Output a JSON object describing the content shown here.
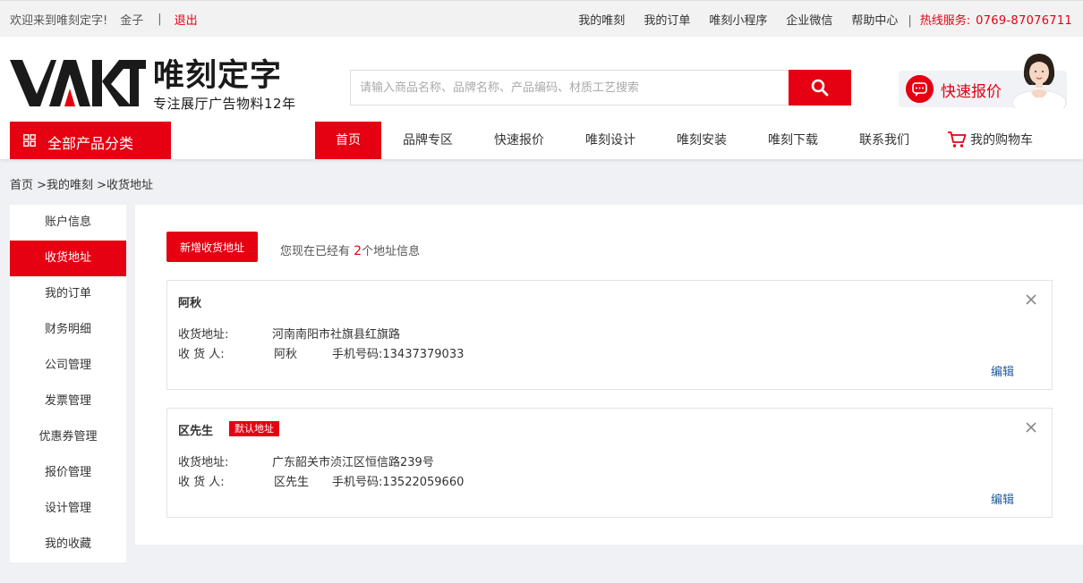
{
  "topbar": {
    "welcome": "欢迎来到唯刻定字!",
    "username": "金子",
    "divider": "|",
    "logout": "退出",
    "links": [
      "我的唯刻",
      "我的订单",
      "唯刻小程序",
      "企业微信",
      "帮助中心"
    ],
    "hotline_label": "热线服务:",
    "hotline_number": "0769-87076711"
  },
  "header": {
    "logo_mark": "VAKT",
    "logo_name": "唯刻定字",
    "logo_slogan": "专注展厅广告物料12年",
    "search_placeholder": "请输入商品名称、品牌名称、产品编码、材质工艺搜索",
    "quick_quote": "快速报价"
  },
  "nav": {
    "all_categories": "全部产品分类",
    "items": [
      "首页",
      "品牌专区",
      "快速报价",
      "唯刻设计",
      "唯刻安装",
      "唯刻下载",
      "联系我们",
      "我的购物车"
    ],
    "active_index": 0
  },
  "breadcrumb": "首页 >我的唯刻 >收货地址",
  "sidebar": {
    "items": [
      "账户信息",
      "收货地址",
      "我的订单",
      "财务明细",
      "公司管理",
      "发票管理",
      "优惠券管理",
      "报价管理",
      "设计管理",
      "我的收藏"
    ],
    "active_index": 1
  },
  "main": {
    "add_button": "新增收货地址",
    "count_prefix": "您现在已经有",
    "count_value": "2",
    "count_suffix": "个地址信息",
    "addresses": [
      {
        "name": "阿秋",
        "default_badge": "",
        "address_label": "收货地址:",
        "address": "河南南阳市社旗县红旗路",
        "receiver_label": "收 货 人:",
        "receiver": "阿秋",
        "phone_label": "手机号码:",
        "phone": "13437379033",
        "edit": "编辑"
      },
      {
        "name": "区先生",
        "default_badge": "默认地址",
        "address_label": "收货地址:",
        "address": "广东韶关市浈江区恒信路239号",
        "receiver_label": "收 货 人:",
        "receiver": "区先生",
        "phone_label": "手机号码:",
        "phone": "13522059660",
        "edit": "编辑"
      }
    ]
  },
  "colors": {
    "brand_red": "#e50012",
    "link_blue": "#1e5a9e"
  }
}
